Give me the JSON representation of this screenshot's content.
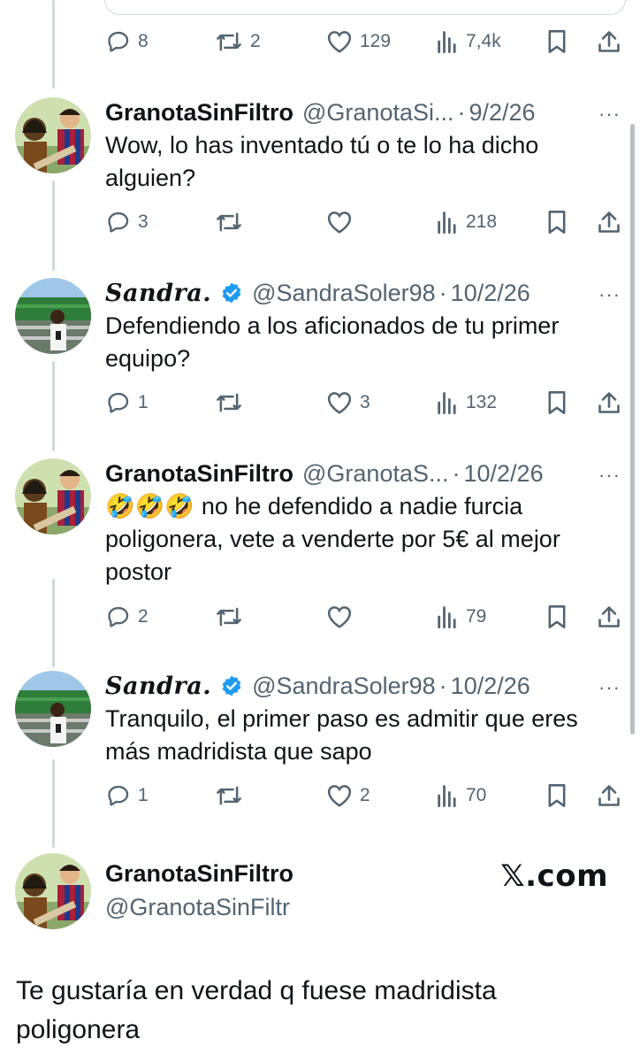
{
  "top_actions": {
    "replies": "8",
    "retweets": "2",
    "likes": "129",
    "views": "7,4k"
  },
  "tweets": [
    {
      "name": "GranotaSinFiltro",
      "handle": "@GranotaSi...",
      "sep": "·",
      "date": "9/2/26",
      "more": "···",
      "text": "Wow, lo has inventado tú o te lo ha dicho alguien?",
      "replies": "3",
      "retweets": "",
      "likes": "",
      "views": "218"
    },
    {
      "name": "Sandra.",
      "handle": "@SandraSoler98",
      "sep": "·",
      "date": "10/2/26",
      "more": "···",
      "verified": true,
      "text": "Defendiendo a los aficionados de tu primer equipo?",
      "replies": "1",
      "retweets": "",
      "likes": "3",
      "views": "132"
    },
    {
      "name": "GranotaSinFiltro",
      "handle": "@GranotaS...",
      "sep": "·",
      "date": "10/2/26",
      "more": "···",
      "text": "no he defendido a nadie furcia poligonera, vete a venderte por 5€ al mejor postor",
      "emoji": "🤣🤣🤣",
      "replies": "2",
      "retweets": "",
      "likes": "",
      "views": "79"
    },
    {
      "name": "Sandra.",
      "handle": "@SandraSoler98",
      "sep": "·",
      "date": "10/2/26",
      "more": "···",
      "verified": true,
      "text": "Tranquilo, el primer paso es admitir que eres más madridista que sapo",
      "replies": "1",
      "retweets": "",
      "likes": "2",
      "views": "70"
    }
  ],
  "bottom": {
    "name": "GranotaSinFiltro",
    "handle": "@GranotaSinFiltr",
    "brand": "𝕏.com",
    "text": "Te gustaría en verdad q fuese madridista poligonera"
  },
  "colors": {
    "text": "#0f1419",
    "secondary": "#536471",
    "verified": "#1d9bf0",
    "thread": "#cfd9de"
  },
  "icons": [
    "reply-icon",
    "retweet-icon",
    "like-icon",
    "views-icon",
    "bookmark-icon",
    "share-icon",
    "verified-badge-icon",
    "more-icon"
  ]
}
